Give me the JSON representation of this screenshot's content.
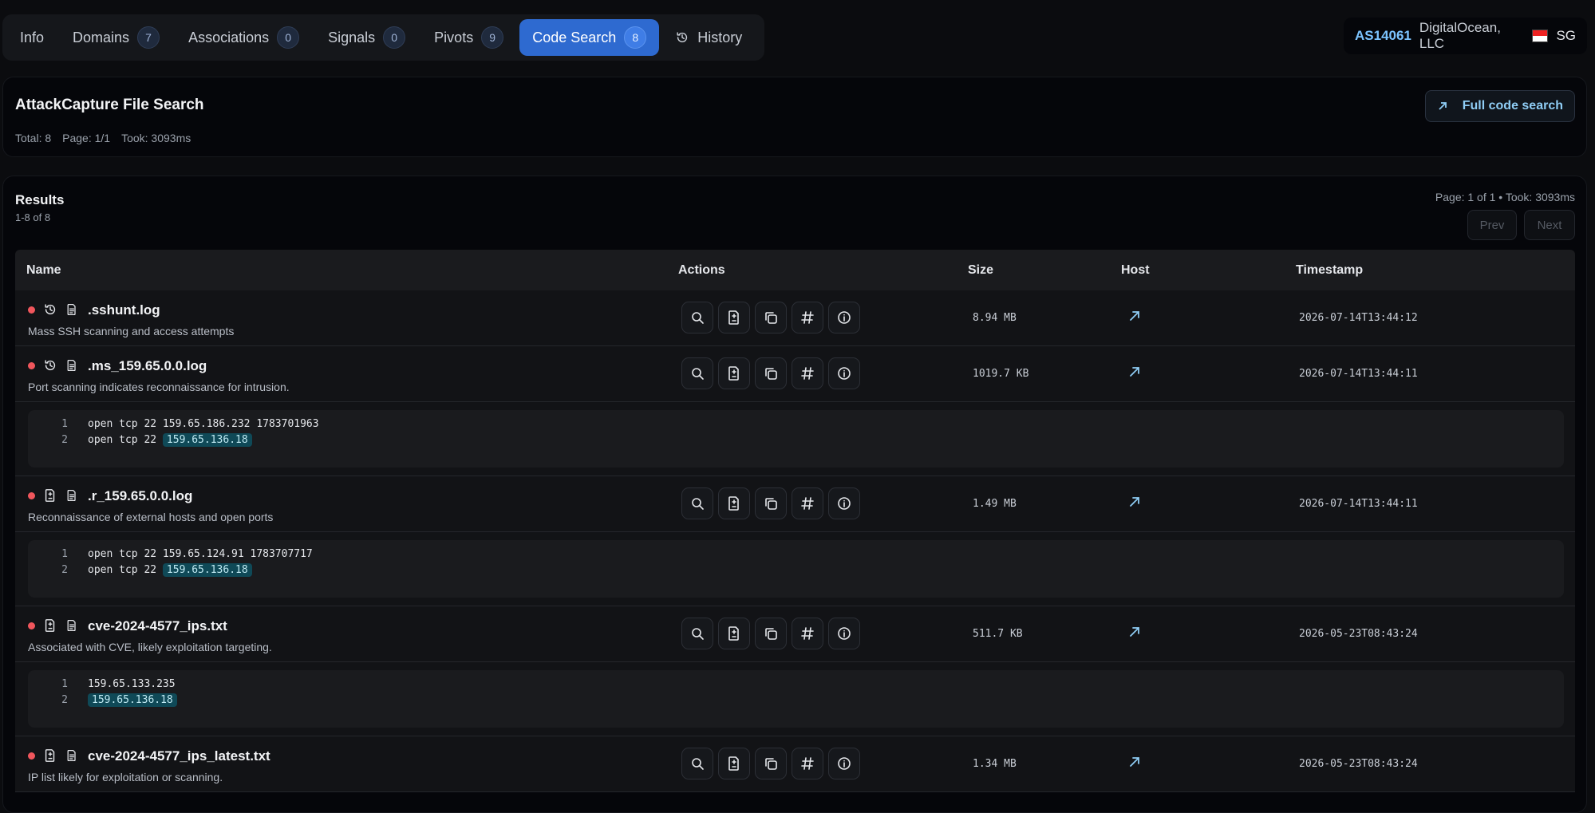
{
  "tabs": [
    {
      "label": "Info",
      "badge": null,
      "active": false
    },
    {
      "label": "Domains",
      "badge": "7",
      "active": false
    },
    {
      "label": "Associations",
      "badge": "0",
      "active": false
    },
    {
      "label": "Signals",
      "badge": "0",
      "active": false
    },
    {
      "label": "Pivots",
      "badge": "9",
      "active": false
    },
    {
      "label": "Code Search",
      "badge": "8",
      "active": true
    },
    {
      "label": "History",
      "badge": null,
      "active": false,
      "icon": "history-icon"
    }
  ],
  "asn": {
    "number": "AS14061",
    "org": "DigitalOcean, LLC",
    "country": "SG"
  },
  "search": {
    "title": "AttackCapture File Search",
    "total": "Total: 8",
    "page": "Page: 1/1",
    "took": "Took: 3093ms",
    "full_button": "Full code search"
  },
  "results": {
    "title": "Results",
    "count": "1-8 of 8",
    "page_info": "Page: 1 of 1 • Took: 3093ms",
    "prev": "Prev",
    "next": "Next",
    "columns": {
      "name": "Name",
      "actions": "Actions",
      "size": "Size",
      "host": "Host",
      "timestamp": "Timestamp"
    },
    "rows": [
      {
        "name": ".sshunt.log",
        "desc": "Mass SSH scanning and access attempts",
        "size": "8.94 MB",
        "timestamp": "2026-07-14T13:44:12",
        "icon": "history-icon",
        "snippet": null
      },
      {
        "name": ".ms_159.65.0.0.log",
        "desc": "Port scanning indicates reconnaissance for intrusion.",
        "size": "1019.7 KB",
        "timestamp": "2026-07-14T13:44:11",
        "icon": "history-icon",
        "snippet": [
          {
            "n": "1",
            "text": "open tcp 22 159.65.186.232 1783701963",
            "hl": ""
          },
          {
            "n": "2",
            "text": "open tcp 22 ",
            "hl": "159.65.136.18"
          }
        ]
      },
      {
        "name": ".r_159.65.0.0.log",
        "desc": "Reconnaissance of external hosts and open ports",
        "size": "1.49 MB",
        "timestamp": "2026-07-14T13:44:11",
        "icon": "file-diff-icon",
        "snippet": [
          {
            "n": "1",
            "text": "open tcp 22 159.65.124.91 1783707717",
            "hl": ""
          },
          {
            "n": "2",
            "text": "open tcp 22 ",
            "hl": "159.65.136.18"
          }
        ]
      },
      {
        "name": "cve-2024-4577_ips.txt",
        "desc": "Associated with CVE, likely exploitation targeting.",
        "size": "511.7 KB",
        "timestamp": "2026-05-23T08:43:24",
        "icon": "file-diff-icon",
        "snippet": [
          {
            "n": "1",
            "text": "159.65.133.235",
            "hl": ""
          },
          {
            "n": "2",
            "text": "",
            "hl": "159.65.136.18"
          }
        ]
      },
      {
        "name": "cve-2024-4577_ips_latest.txt",
        "desc": "IP list likely for exploitation or scanning.",
        "size": "1.34 MB",
        "timestamp": "2026-05-23T08:43:24",
        "icon": "file-diff-icon",
        "snippet": null
      }
    ]
  },
  "colors": {
    "accent": "#2e6ad0",
    "status_dot": "#f0565c",
    "link": "#8fcdf5",
    "highlight_bg": "#0f4957"
  }
}
